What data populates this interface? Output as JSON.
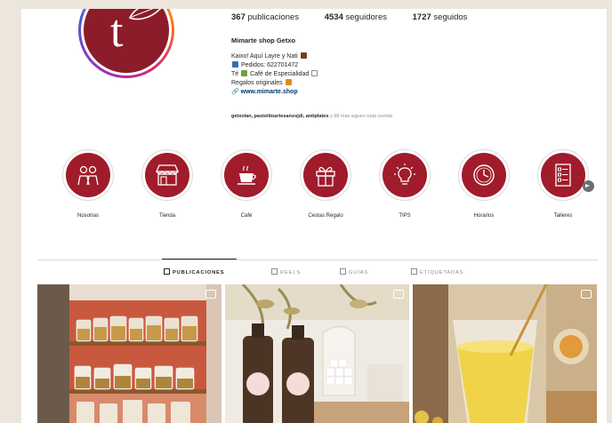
{
  "profile": {
    "stats": {
      "posts_count": "367",
      "posts_label": "publicaciones",
      "followers_count": "4534",
      "followers_label": "seguidores",
      "following_count": "1727",
      "following_label": "seguidos"
    },
    "username": "Mimarte shop Getxo",
    "bio": {
      "line1": "Kaixo! Aquí Layre y Nati",
      "line2": "Pedidos: 622701472",
      "line3_prefix": "Té",
      "line3_suffix": "Café de Especialidad",
      "line4": "Regalos originales",
      "link": "www.mimarte.shop"
    },
    "followed_by": {
      "names": "getxolan, pastelitoartesanosjdi, antiplates",
      "rest": "y 98 más siguen esta cuenta"
    },
    "emoji_colors": {
      "gift": "#7a3e1e",
      "phone": "#2f6fb3",
      "tea": "#6aa33c",
      "coffee": "#8c8c8c",
      "box": "#e08a1e"
    }
  },
  "highlights": [
    {
      "label": "Nosotras",
      "icon": "people-icon"
    },
    {
      "label": "Tienda",
      "icon": "shop-icon"
    },
    {
      "label": "Café",
      "icon": "coffee-cup-icon"
    },
    {
      "label": "Cestas Regalo",
      "icon": "gift-icon"
    },
    {
      "label": "TIPS",
      "icon": "lightbulb-icon"
    },
    {
      "label": "Horarios",
      "icon": "clock-icon"
    },
    {
      "label": "Talleres",
      "icon": "checklist-icon"
    }
  ],
  "tabs": [
    {
      "label": "PUBLICACIONES",
      "active": true
    },
    {
      "label": "REELS",
      "active": false
    },
    {
      "label": "GUÍAS",
      "active": false
    },
    {
      "label": "ETIQUETADAS",
      "active": false
    }
  ],
  "posts": [
    {
      "subject": "shop shelves with glass jars",
      "icon": "carousel-icon"
    },
    {
      "subject": "amber bottles and sugar jar",
      "icon": "carousel-icon"
    },
    {
      "subject": "golden turmeric latte",
      "icon": "carousel-icon"
    }
  ],
  "colors": {
    "brand": "#a01b2b",
    "brand_dark": "#8c1c2a",
    "link": "#00376b"
  }
}
